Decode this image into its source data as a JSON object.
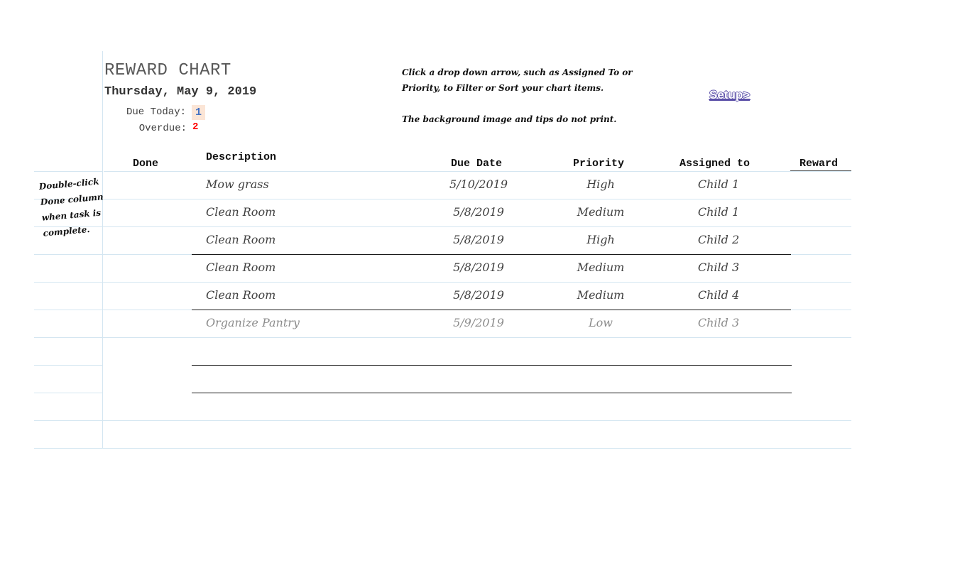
{
  "header": {
    "title": "REWARD CHART",
    "date": "Thursday, May 9, 2019",
    "due_today_label": "Due Today:",
    "due_today_value": "1",
    "overdue_label": "Overdue:",
    "overdue_value": "2"
  },
  "tips": {
    "line1": "Click a drop down arrow, such as Assigned To or",
    "line2": "Priority, to Filter or Sort your chart items.",
    "line3": "The background image and tips do not print."
  },
  "setup_link": "Setup>",
  "side_note": {
    "line1": "Double-click",
    "line2": "Done column",
    "line3": "when task is",
    "line4": "complete."
  },
  "columns": {
    "done": "Done",
    "description": "Description",
    "due_date": "Due Date",
    "priority": "Priority",
    "assigned_to": "Assigned to",
    "reward": "Reward"
  },
  "rows": [
    {
      "done": "",
      "description": "Mow grass",
      "due_date": "5/10/2019",
      "priority": "High",
      "assigned_to": "Child 1",
      "reward": ""
    },
    {
      "done": "",
      "description": "Clean Room",
      "due_date": "5/8/2019",
      "priority": "Medium",
      "assigned_to": "Child 1",
      "reward": ""
    },
    {
      "done": "",
      "description": "Clean Room",
      "due_date": "5/8/2019",
      "priority": "High",
      "assigned_to": "Child 2",
      "reward": ""
    },
    {
      "done": "",
      "description": "Clean Room",
      "due_date": "5/8/2019",
      "priority": "Medium",
      "assigned_to": "Child 3",
      "reward": ""
    },
    {
      "done": "",
      "description": "Clean Room",
      "due_date": "5/8/2019",
      "priority": "Medium",
      "assigned_to": "Child 4",
      "reward": ""
    },
    {
      "done": "",
      "description": "Organize Pantry",
      "due_date": "5/9/2019",
      "priority": "Low",
      "assigned_to": "Child 3",
      "reward": ""
    }
  ],
  "colors": {
    "due_today_bg": "#fbe5d6",
    "due_today_text": "#4472c4",
    "overdue_text": "#ff0000",
    "grid_line": "#d4e6f1",
    "muted_row_text": "#8c8c8c"
  }
}
